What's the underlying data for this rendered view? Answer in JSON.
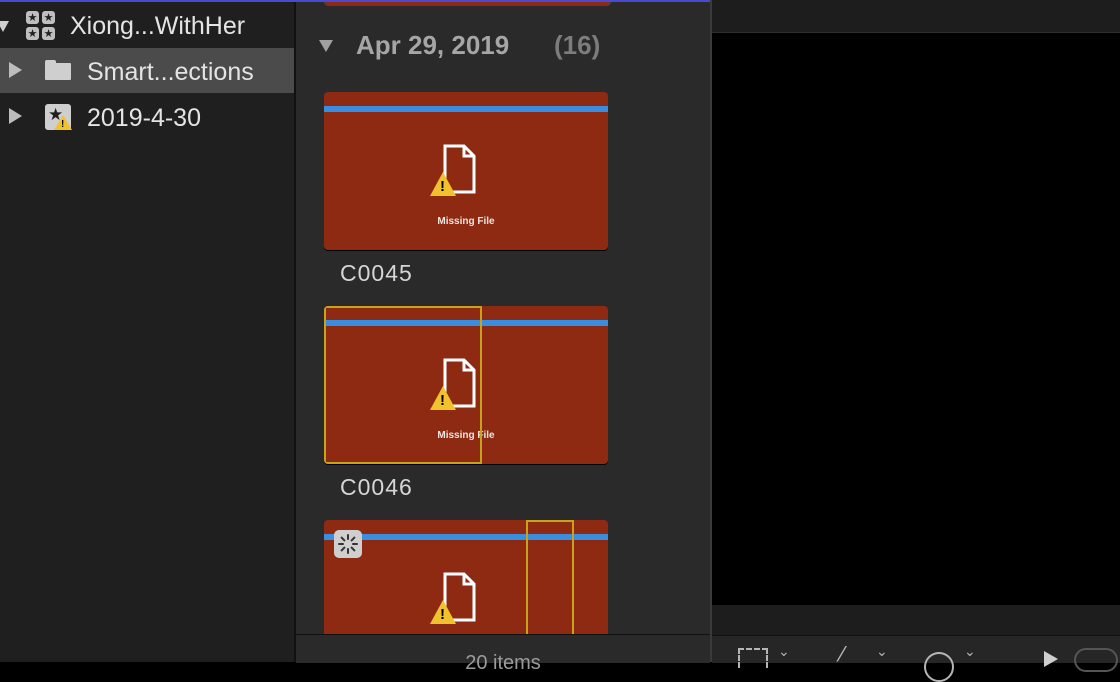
{
  "sidebar": {
    "library": {
      "label": "Xiong...WithHer",
      "icon": "library-icon"
    },
    "items": [
      {
        "label": "Smart...ections",
        "icon": "folder-icon",
        "selected": true
      },
      {
        "label": "2019-4-30",
        "icon": "event-warning-icon",
        "selected": false
      }
    ]
  },
  "browser": {
    "group": {
      "date": "Apr 29, 2019",
      "count": "(16)"
    },
    "clips": [
      {
        "name": "C0045",
        "status": "Missing File"
      },
      {
        "name": "C0046",
        "status": "Missing File"
      },
      {
        "name": "",
        "status": ""
      }
    ],
    "footer": "20 items"
  },
  "colors": {
    "clip_fill": "#8e2a12",
    "audio_bar": "#3a8ee0",
    "selection": "#c8a21a",
    "warning": "#f2c12e"
  }
}
